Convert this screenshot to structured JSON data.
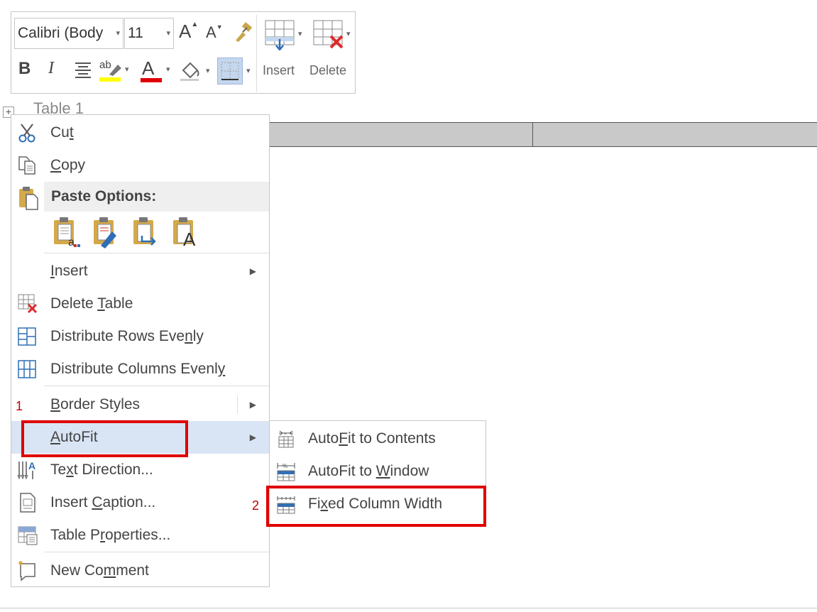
{
  "mini_toolbar": {
    "font_name": "Calibri (Body",
    "font_size": "11",
    "grow_font": "A",
    "shrink_font": "A",
    "bold": "B",
    "italic": "I",
    "font_color": "A",
    "highlight": "ab",
    "insert_label": "Insert",
    "delete_label": "Delete",
    "highlight_color": "#ffff00",
    "font_color_value": "#e00000"
  },
  "document": {
    "table_caption": "Table 1",
    "move_handle": "+"
  },
  "context_menu": {
    "cut_pre": "Cu",
    "cut_u": "t",
    "cut_post": "",
    "copy_pre": "",
    "copy_u": "C",
    "copy_post": "opy",
    "paste_options": "Paste Options:",
    "paste_text_only_letter": "A",
    "insert_pre": "",
    "insert_u": "I",
    "insert_post": "nsert",
    "delete_table_pre": "Delete ",
    "delete_table_u": "T",
    "delete_table_post": "able",
    "dist_rows_pre": "Distribute Rows Eve",
    "dist_rows_u": "n",
    "dist_rows_post": "ly",
    "dist_cols_pre": "Distribute Columns Evenl",
    "dist_cols_u": "y",
    "dist_cols_post": "",
    "border_styles_pre": "",
    "border_styles_u": "B",
    "border_styles_post": "order Styles",
    "autofit_pre": "",
    "autofit_u": "A",
    "autofit_post": "utoFit",
    "text_dir_pre": "Te",
    "text_dir_u": "x",
    "text_dir_post": "t Direction...",
    "insert_caption_pre": "Insert ",
    "insert_caption_u": "C",
    "insert_caption_post": "aption...",
    "table_props_pre": "Table P",
    "table_props_u": "r",
    "table_props_post": "operties...",
    "new_comment_pre": "New Co",
    "new_comment_u": "m",
    "new_comment_post": "ment"
  },
  "submenu": {
    "autofit_contents_pre": "Auto",
    "autofit_contents_u": "F",
    "autofit_contents_post": "it to Contents",
    "autofit_window_pre": "AutoFit to ",
    "autofit_window_u": "W",
    "autofit_window_post": "indow",
    "fixed_width_pre": "Fi",
    "fixed_width_u": "x",
    "fixed_width_post": "ed Column Width"
  },
  "annotations": {
    "step1": "1",
    "step2": "2",
    "callout_color": "#e00000"
  },
  "icons": [
    "scissors-icon",
    "copy-icon",
    "paste-icon",
    "keep-source-formatting-icon",
    "merge-formatting-icon",
    "picture-paste-icon",
    "keep-text-only-icon",
    "delete-table-icon",
    "distribute-rows-icon",
    "distribute-columns-icon",
    "text-direction-icon",
    "insert-caption-icon",
    "table-properties-icon",
    "new-comment-icon",
    "autofit-contents-icon",
    "autofit-window-icon",
    "fixed-width-icon",
    "format-painter-icon",
    "shading-icon",
    "borders-icon",
    "insert-table-icon",
    "delete-table-toolbar-icon"
  ]
}
